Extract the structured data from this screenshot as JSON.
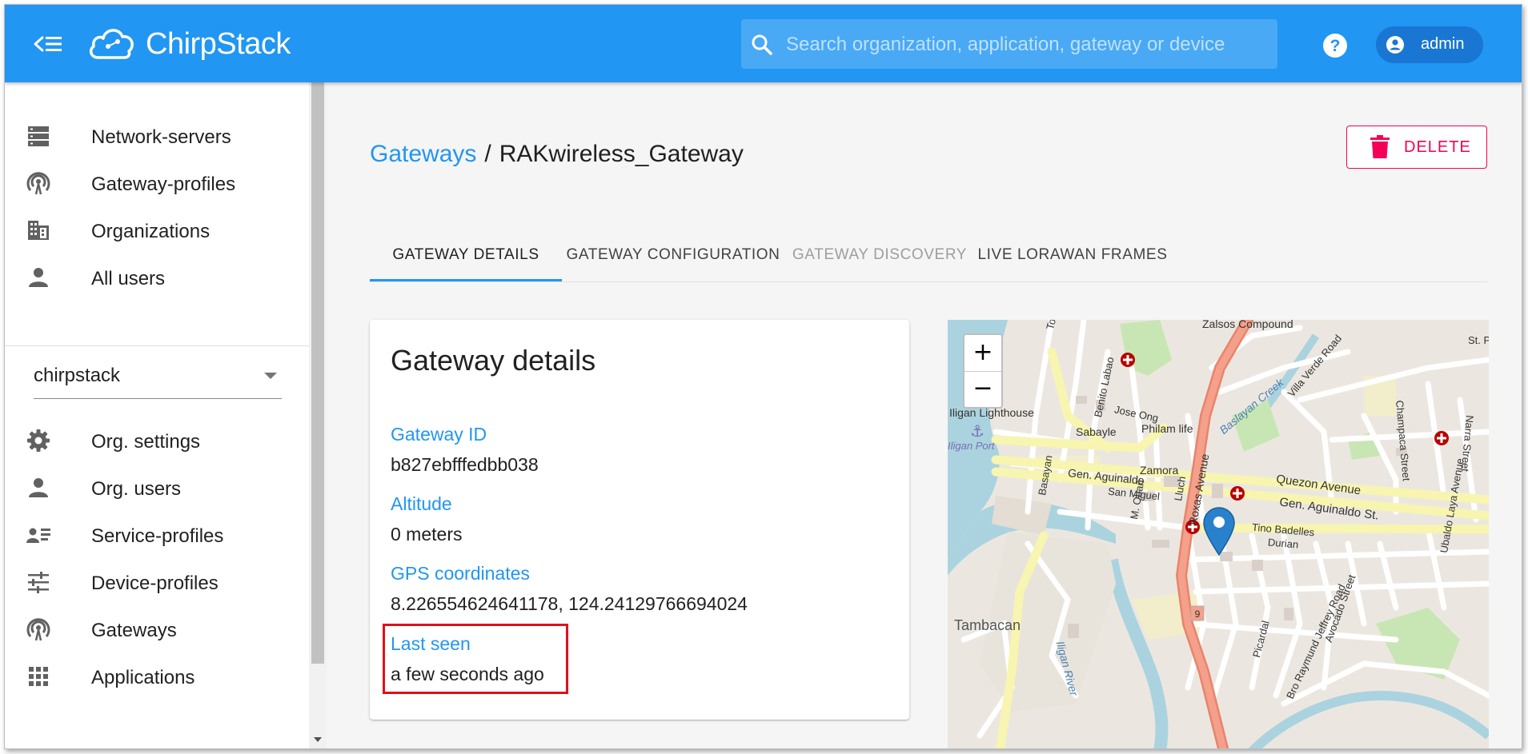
{
  "app": {
    "brand": "ChirpStack",
    "search_placeholder": "Search organization, application, gateway or device",
    "user": "admin"
  },
  "sidebar": {
    "admin_items": [
      {
        "label": "Network-servers",
        "icon": "server-icon"
      },
      {
        "label": "Gateway-profiles",
        "icon": "gateway-icon"
      },
      {
        "label": "Organizations",
        "icon": "building-icon"
      },
      {
        "label": "All users",
        "icon": "person-icon"
      }
    ],
    "organization": "chirpstack",
    "org_items": [
      {
        "label": "Org. settings",
        "icon": "gear-icon"
      },
      {
        "label": "Org. users",
        "icon": "person-icon"
      },
      {
        "label": "Service-profiles",
        "icon": "service-profile-icon"
      },
      {
        "label": "Device-profiles",
        "icon": "sliders-icon"
      },
      {
        "label": "Gateways",
        "icon": "gateway-icon"
      },
      {
        "label": "Applications",
        "icon": "apps-grid-icon"
      }
    ]
  },
  "breadcrumb": {
    "parent": "Gateways",
    "separator": "/",
    "current": "RAKwireless_Gateway"
  },
  "actions": {
    "delete_label": "DELETE"
  },
  "tabs": [
    {
      "label": "GATEWAY DETAILS",
      "active": true
    },
    {
      "label": "GATEWAY CONFIGURATION",
      "active": false
    },
    {
      "label": "GATEWAY DISCOVERY",
      "active": false,
      "disabled": true
    },
    {
      "label": "LIVE LORAWAN FRAMES",
      "active": false
    }
  ],
  "details": {
    "title": "Gateway details",
    "fields": [
      {
        "label": "Gateway ID",
        "value": "b827ebfffedbb038"
      },
      {
        "label": "Altitude",
        "value": "0 meters"
      },
      {
        "label": "GPS coordinates",
        "value": "8.226554624641178, 124.24129766694024"
      },
      {
        "label": "Last seen",
        "value": "a few seconds ago"
      }
    ]
  },
  "map": {
    "zoom_in": "+",
    "zoom_out": "−",
    "labels": [
      "Zalsos Compound",
      "Tomas Cabili Avenue",
      "Benito Labao",
      "Jose Ong",
      "Iligan Lighthouse",
      "Iligan Port",
      "Sabayle",
      "Philam life",
      "Baslayan Creek",
      "Villa Verde Road",
      "Zamora",
      "M. Obañ",
      "Lluch",
      "Roxas Avenue",
      "Basayan",
      "Gen. Aguinaldo",
      "San Miguel",
      "Quezon Avenue",
      "Gen. Aguinaldo St.",
      "Tino Badelles",
      "Durian",
      "Bro Raymund Jeffrey Road",
      "Picardal",
      "Avocado Street",
      "Champaca Street",
      "Narra Street",
      "Ubaldo Laya Avenue",
      "St. P",
      "Tambacan",
      "Iligan River",
      "9"
    ]
  },
  "colors": {
    "primary": "#2196f3",
    "primary_dark": "#1976d2",
    "delete": "#f50057",
    "highlight": "#e0101a"
  }
}
